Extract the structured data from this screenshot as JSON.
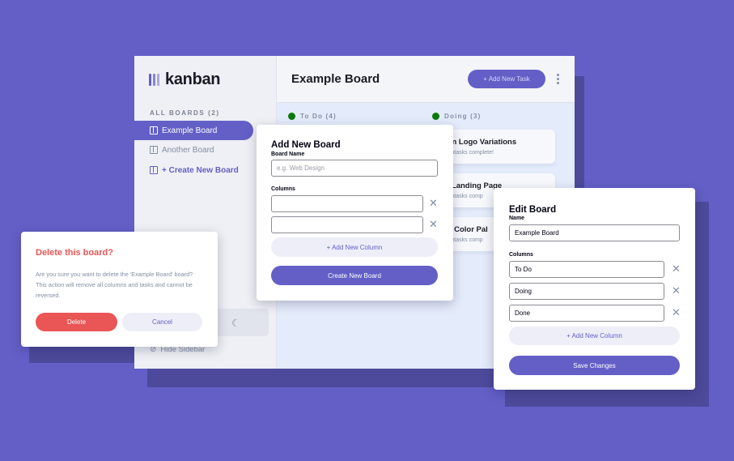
{
  "app": {
    "logo_text": "kanban",
    "all_boards_label": "ALL BOARDS (2)",
    "boards": [
      {
        "label": "Example Board"
      },
      {
        "label": "Another Board"
      }
    ],
    "create_board_label": "+ Create New Board",
    "hide_sidebar_label": "Hide Sidebar",
    "board_title": "Example Board",
    "add_task_label": "+ Add New Task",
    "columns": [
      {
        "label": "To Do (4)"
      },
      {
        "label": "Doing (3)"
      }
    ],
    "doing_tasks": [
      {
        "title": "ign Logo Variations",
        "sub": "subtasks complete!"
      },
      {
        "title": "e Landing Page",
        "sub": "subtasks comp"
      },
      {
        "title": "ct Color Pal",
        "sub": "subtasks comp"
      }
    ]
  },
  "add_board_modal": {
    "title": "Add New Board",
    "name_label": "Board Name",
    "name_placeholder": "e.g. Web Design",
    "columns_label": "Columns",
    "add_column_label": "+ Add New Column",
    "create_label": "Create New Board"
  },
  "edit_board_modal": {
    "title": "Edit Board",
    "name_label": "Name",
    "name_value": "Example Board",
    "columns_label": "Columns",
    "columns": [
      "To Do",
      "Doing",
      "Done"
    ],
    "add_column_label": "+ Add New Column",
    "save_label": "Save Changes"
  },
  "delete_modal": {
    "title": "Delete this board?",
    "message": "Are you sure you want to delete the 'Example Board' board? This action will remove all columns and tasks and cannot be reversed.",
    "delete_label": "Delete",
    "cancel_label": "Cancel"
  },
  "colors": {
    "background": "#635fc7",
    "primary": "#635fc7",
    "danger": "#ea5555",
    "status_green": "#0a7a0a"
  }
}
